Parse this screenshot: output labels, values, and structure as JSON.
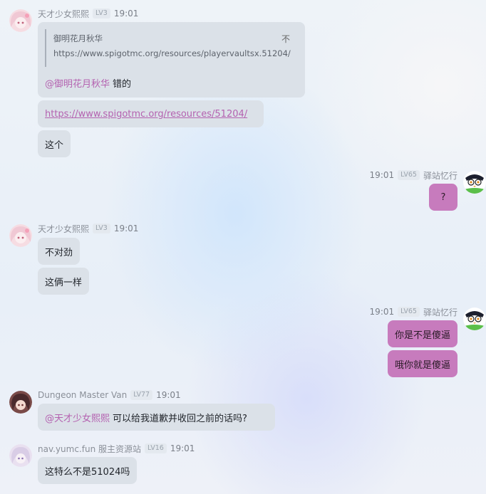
{
  "messages": [
    {
      "sender": "天才少女熙熙",
      "level": "LV3",
      "time": "19:01",
      "quote": {
        "author": "御明花月秋华",
        "close": "不",
        "text": "https://www.spigotmc.org/resources/playervaultsx.51204/"
      },
      "reply_mention": "@御明花月秋华",
      "reply_text": "错的",
      "link": "https://www.spigotmc.org/resources/51204/",
      "text3": "这个"
    },
    {
      "sender": "驿站忆行",
      "level": "LV65",
      "time": "19:01",
      "text": "?"
    },
    {
      "sender": "天才少女熙熙",
      "level": "LV3",
      "time": "19:01",
      "text1": "不对劲",
      "text2": "这俩一样"
    },
    {
      "sender": "驿站忆行",
      "level": "LV65",
      "time": "19:01",
      "text1": "你是不是傻逼",
      "text2": "哦你就是傻逼"
    },
    {
      "sender": "Dungeon Master Van",
      "level": "LV77",
      "time": "19:01",
      "mention": "@天才少女熙熙",
      "text": "可以给我道歉并收回之前的话吗?"
    },
    {
      "sender": "nav.yumc.fun 服主资源站",
      "level": "LV16",
      "time": "19:01",
      "text": "这特么不是51024吗"
    }
  ],
  "colors": {
    "self_bubble": "#c77bbd",
    "other_bubble": "#dbe1e8",
    "mention": "#b462b0"
  }
}
